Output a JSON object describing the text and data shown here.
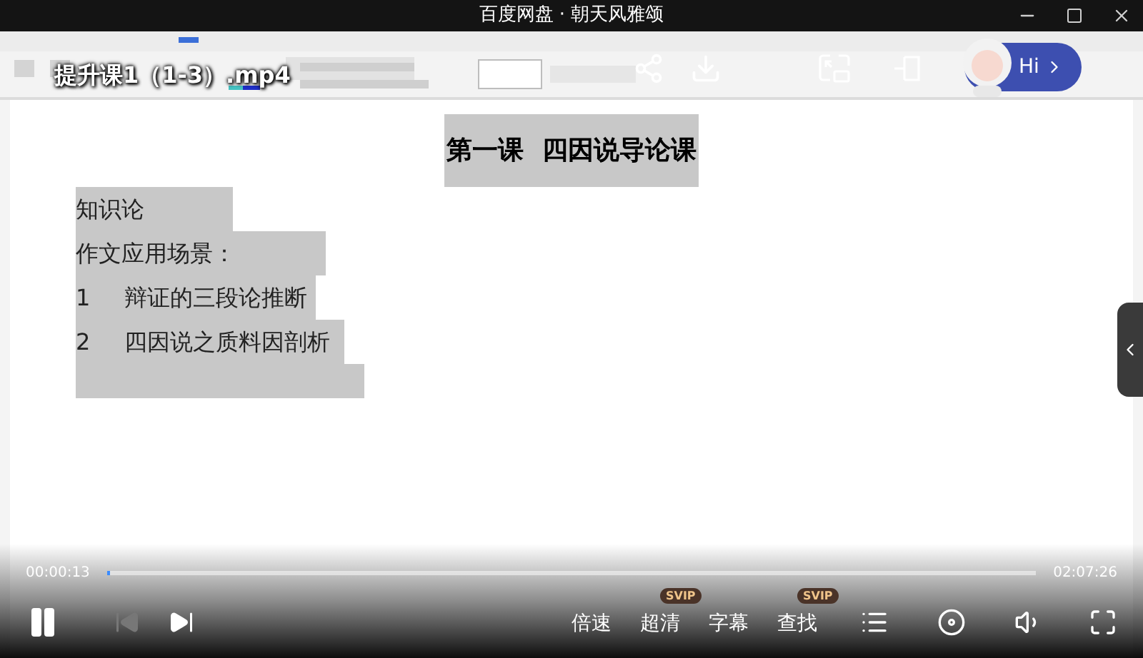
{
  "window": {
    "title": "百度网盘 · 朝天风雅颂"
  },
  "video": {
    "file_name": "提升课1（1-3）.mp4"
  },
  "assistant": {
    "label": "Hi"
  },
  "document": {
    "title": "第一课  四因说导论课",
    "lines": [
      {
        "text": "知识论"
      },
      {
        "text": "作文应用场景："
      },
      {
        "number": "1",
        "text": "辩证的三段论推断"
      },
      {
        "number": "2",
        "text": "四因说之质料因剖析"
      }
    ]
  },
  "player": {
    "elapsed": "00:00:13",
    "duration": "02:07:26",
    "level": 0.002,
    "playing": true,
    "previous_disabled": true,
    "options": [
      {
        "label": "倍速"
      },
      {
        "label": "超清",
        "badge": "SVIP"
      },
      {
        "label": "字幕"
      },
      {
        "label": "查找",
        "badge": "SVIP"
      }
    ]
  }
}
